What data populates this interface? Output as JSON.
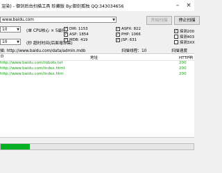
{
  "title": "渲染) - 御剑后台扫描工具 珍藏版 By:御剑孤独 QQ:343034656",
  "domain_input": "www.baidu.com",
  "threads": {
    "value": "10",
    "note": "(单 CPU核心 × 5最佳)"
  },
  "timeout": {
    "value": "10",
    "note": "(秒 超时时间(后面增添需)"
  },
  "buttons": {
    "start": "开始扫描",
    "stop": "停止扫描"
  },
  "dicts": [
    {
      "label": "DIR: 1153",
      "checked": true
    },
    {
      "label": "ASP: 1854",
      "checked": true
    },
    {
      "label": "MDB: 419",
      "checked": true
    },
    {
      "label": "ASPX: 822",
      "checked": true
    },
    {
      "label": "PHP: 1066",
      "checked": true
    },
    {
      "label": "JSP: 631",
      "checked": true
    }
  ],
  "right_options": [
    {
      "label": "探测200",
      "checked": true
    },
    {
      "label": "探测403",
      "checked": false
    },
    {
      "label": "探测3XX",
      "checked": false
    }
  ],
  "scan_status": {
    "current_url": "描: http://www.baidu.com/data/admin.mdb",
    "speed_label": "扫描线程：10",
    "count_label": "扫描速度"
  },
  "list": {
    "col_id": "D",
    "col_addr": "地址",
    "col_status": "HTTP响",
    "rows": [
      {
        "url": "http://www.baidu.com/robots.txt",
        "status": "200"
      },
      {
        "url": "http://www.baidu.com/index.html",
        "status": "200"
      },
      {
        "url": "http://www.baidu.com/index.htm",
        "status": "200"
      }
    ]
  },
  "progress_fraction": 0.15,
  "colors": {
    "progress": "#06b025",
    "found": "#1a9a1a"
  }
}
